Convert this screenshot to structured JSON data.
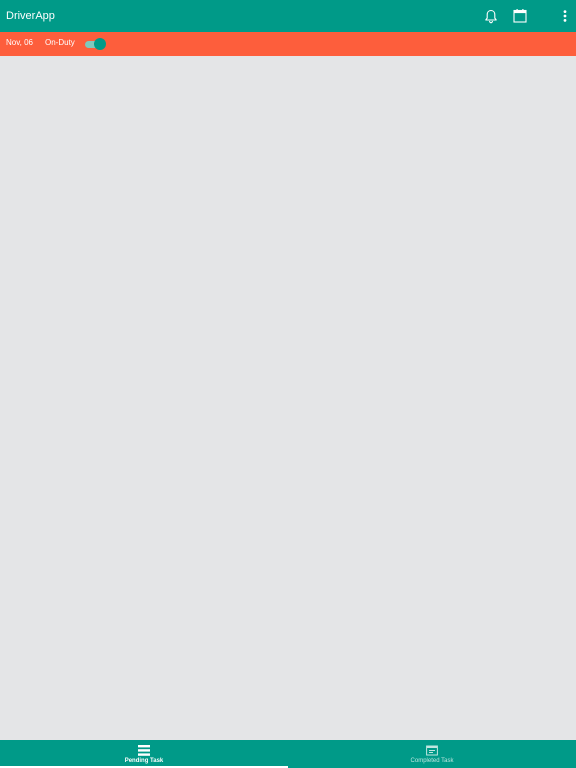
{
  "app_bar": {
    "title": "DriverApp",
    "background": "#009a88",
    "actions": [
      {
        "icon": "bell-icon"
      },
      {
        "icon": "calendar-icon"
      },
      {
        "icon": "more-vertical-icon"
      }
    ]
  },
  "status_bar": {
    "date": "Nov, 06",
    "duty_label": "On-Duty",
    "duty_on": true,
    "background": "#fd5e3c"
  },
  "bottom_nav": {
    "background": "#009a88",
    "tabs": [
      {
        "label": "Pending Task",
        "icon": "list-icon",
        "selected": true
      },
      {
        "label": "Completed Task",
        "icon": "completed-task-icon",
        "selected": false
      }
    ]
  }
}
